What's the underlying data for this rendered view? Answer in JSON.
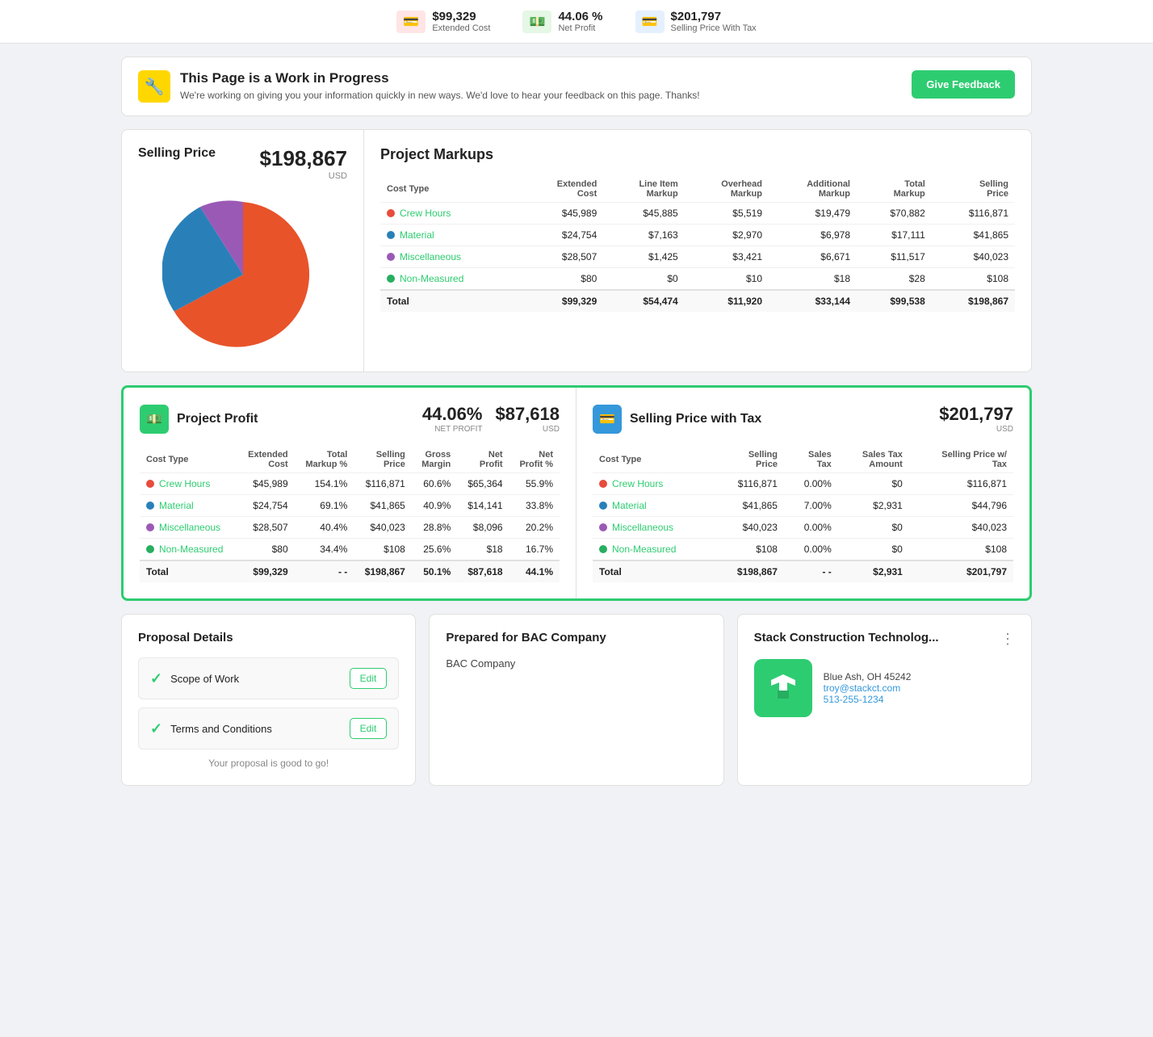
{
  "topBar": {
    "stats": [
      {
        "icon": "💳",
        "iconClass": "icon-red",
        "amount": "$99,329",
        "label": "Extended Cost"
      },
      {
        "icon": "💵",
        "iconClass": "icon-green",
        "amount": "44.06 %",
        "label": "Net Profit"
      },
      {
        "icon": "💳",
        "iconClass": "icon-blue",
        "amount": "$201,797",
        "label": "Selling Price With Tax"
      }
    ]
  },
  "wipBanner": {
    "icon": "🔧",
    "title": "This Page is a Work in Progress",
    "subtitle": "We're working on giving you your information quickly in new ways. We'd love to hear your feedback on this page. Thanks!",
    "buttonLabel": "Give Feedback"
  },
  "sellingPrice": {
    "title": "Selling Price",
    "amount": "$198,867",
    "currency": "USD"
  },
  "projectMarkups": {
    "title": "Project Markups",
    "headers": [
      "Cost Type",
      "Extended Cost",
      "Line Item Markup",
      "Overhead Markup",
      "Additional Markup",
      "Total Markup",
      "Selling Price"
    ],
    "rows": [
      {
        "type": "Crew Hours",
        "colorClass": "dot-red",
        "extCost": "$45,989",
        "lineMarkup": "$45,885",
        "overheadMarkup": "$5,519",
        "addMarkup": "$19,479",
        "totalMarkup": "$70,882",
        "sellingPrice": "$116,871"
      },
      {
        "type": "Material",
        "colorClass": "dot-blue",
        "extCost": "$24,754",
        "lineMarkup": "$7,163",
        "overheadMarkup": "$2,970",
        "addMarkup": "$6,978",
        "totalMarkup": "$17,111",
        "sellingPrice": "$41,865"
      },
      {
        "type": "Miscellaneous",
        "colorClass": "dot-purple",
        "extCost": "$28,507",
        "lineMarkup": "$1,425",
        "overheadMarkup": "$3,421",
        "addMarkup": "$6,671",
        "totalMarkup": "$11,517",
        "sellingPrice": "$40,023"
      },
      {
        "type": "Non-Measured",
        "colorClass": "dot-green",
        "extCost": "$80",
        "lineMarkup": "$0",
        "overheadMarkup": "$10",
        "addMarkup": "$18",
        "totalMarkup": "$28",
        "sellingPrice": "$108"
      }
    ],
    "total": {
      "label": "Total",
      "extCost": "$99,329",
      "lineMarkup": "$54,474",
      "overheadMarkup": "$11,920",
      "addMarkup": "$33,144",
      "totalMarkup": "$99,538",
      "sellingPrice": "$198,867"
    }
  },
  "projectProfit": {
    "title": "Project Profit",
    "percent": "44.06%",
    "percentLabel": "NET PROFIT",
    "amount": "$87,618",
    "amountLabel": "USD",
    "headers": [
      "Cost Type",
      "Extended Cost",
      "Total Markup %",
      "Selling Price",
      "Gross Margin",
      "Net Profit",
      "Net Profit %"
    ],
    "rows": [
      {
        "type": "Crew Hours",
        "colorClass": "dot-red",
        "extCost": "$45,989",
        "totalMarkupPct": "154.1%",
        "sellingPrice": "$116,871",
        "grossMargin": "60.6%",
        "netProfit": "$65,364",
        "netProfitPct": "55.9%"
      },
      {
        "type": "Material",
        "colorClass": "dot-blue",
        "extCost": "$24,754",
        "totalMarkupPct": "69.1%",
        "sellingPrice": "$41,865",
        "grossMargin": "40.9%",
        "netProfit": "$14,141",
        "netProfitPct": "33.8%"
      },
      {
        "type": "Miscellaneous",
        "colorClass": "dot-purple",
        "extCost": "$28,507",
        "totalMarkupPct": "40.4%",
        "sellingPrice": "$40,023",
        "grossMargin": "28.8%",
        "netProfit": "$8,096",
        "netProfitPct": "20.2%"
      },
      {
        "type": "Non-Measured",
        "colorClass": "dot-green",
        "extCost": "$80",
        "totalMarkupPct": "34.4%",
        "sellingPrice": "$108",
        "grossMargin": "25.6%",
        "netProfit": "$18",
        "netProfitPct": "16.7%"
      }
    ],
    "total": {
      "label": "Total",
      "extCost": "$99,329",
      "totalMarkupPct": "- -",
      "sellingPrice": "$198,867",
      "grossMargin": "50.1%",
      "netProfit": "$87,618",
      "netProfitPct": "44.1%"
    }
  },
  "sellingPriceWithTax": {
    "title": "Selling Price with Tax",
    "amount": "$201,797",
    "amountLabel": "USD",
    "headers": [
      "Cost Type",
      "Selling Price",
      "Sales Tax",
      "Sales Tax Amount",
      "Selling Price w/ Tax"
    ],
    "rows": [
      {
        "type": "Crew Hours",
        "colorClass": "dot-red",
        "sellingPrice": "$116,871",
        "salesTax": "0.00%",
        "taxAmount": "$0",
        "spWithTax": "$116,871"
      },
      {
        "type": "Material",
        "colorClass": "dot-blue",
        "sellingPrice": "$41,865",
        "salesTax": "7.00%",
        "taxAmount": "$2,931",
        "spWithTax": "$44,796"
      },
      {
        "type": "Miscellaneous",
        "colorClass": "dot-purple",
        "sellingPrice": "$40,023",
        "salesTax": "0.00%",
        "taxAmount": "$0",
        "spWithTax": "$40,023"
      },
      {
        "type": "Non-Measured",
        "colorClass": "dot-green",
        "sellingPrice": "$108",
        "salesTax": "0.00%",
        "taxAmount": "$0",
        "spWithTax": "$108"
      }
    ],
    "total": {
      "label": "Total",
      "sellingPrice": "$198,867",
      "salesTax": "- -",
      "taxAmount": "$2,931",
      "spWithTax": "$201,797"
    }
  },
  "proposalDetails": {
    "title": "Proposal Details",
    "items": [
      {
        "label": "Scope of Work",
        "editLabel": "Edit"
      },
      {
        "label": "Terms and Conditions",
        "editLabel": "Edit"
      }
    ],
    "goodToGo": "Your proposal is good to go!"
  },
  "preparedFor": {
    "title": "Prepared for BAC Company",
    "company": "BAC Company"
  },
  "contractor": {
    "title": "Stack Construction Technolog...",
    "city": "Blue Ash, OH 45242",
    "email": "troy@stackct.com",
    "phone": "513-255-1234"
  },
  "pieChart": {
    "segments": [
      {
        "color": "#e74c3c",
        "percentage": 58.8,
        "label": "Crew Hours"
      },
      {
        "color": "#2980b9",
        "percentage": 21.1,
        "label": "Material"
      },
      {
        "color": "#9b59b6",
        "percentage": 20.1,
        "label": "Miscellaneous"
      }
    ]
  }
}
